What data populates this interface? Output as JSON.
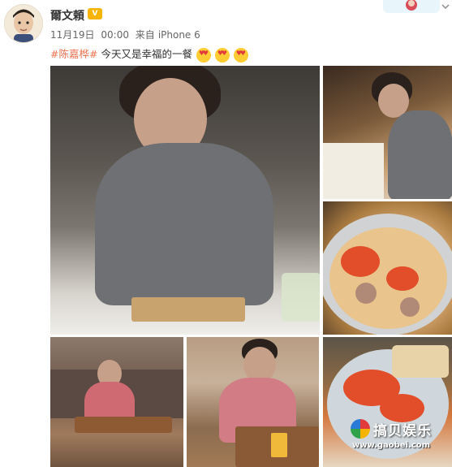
{
  "post": {
    "username": "爾文頼",
    "vip_badge": "V",
    "date": "11月19日",
    "time": "00:00",
    "source_prefix": "来自",
    "source": "iPhone 6",
    "hashtag": "#陈嘉桦#",
    "text": "今天又是幸福的一餐"
  },
  "icons": {
    "avatar": "child-avatar",
    "badge": "vip-badge-icon",
    "more": "chevron-down-icon",
    "emoji": "heart-eyes-emoji"
  },
  "watermark": {
    "title": "搞贝娱乐",
    "url": "www.gaobei.com"
  },
  "colors": {
    "hashtag": "#eb7350",
    "username": "#333333",
    "meta": "#666666"
  }
}
